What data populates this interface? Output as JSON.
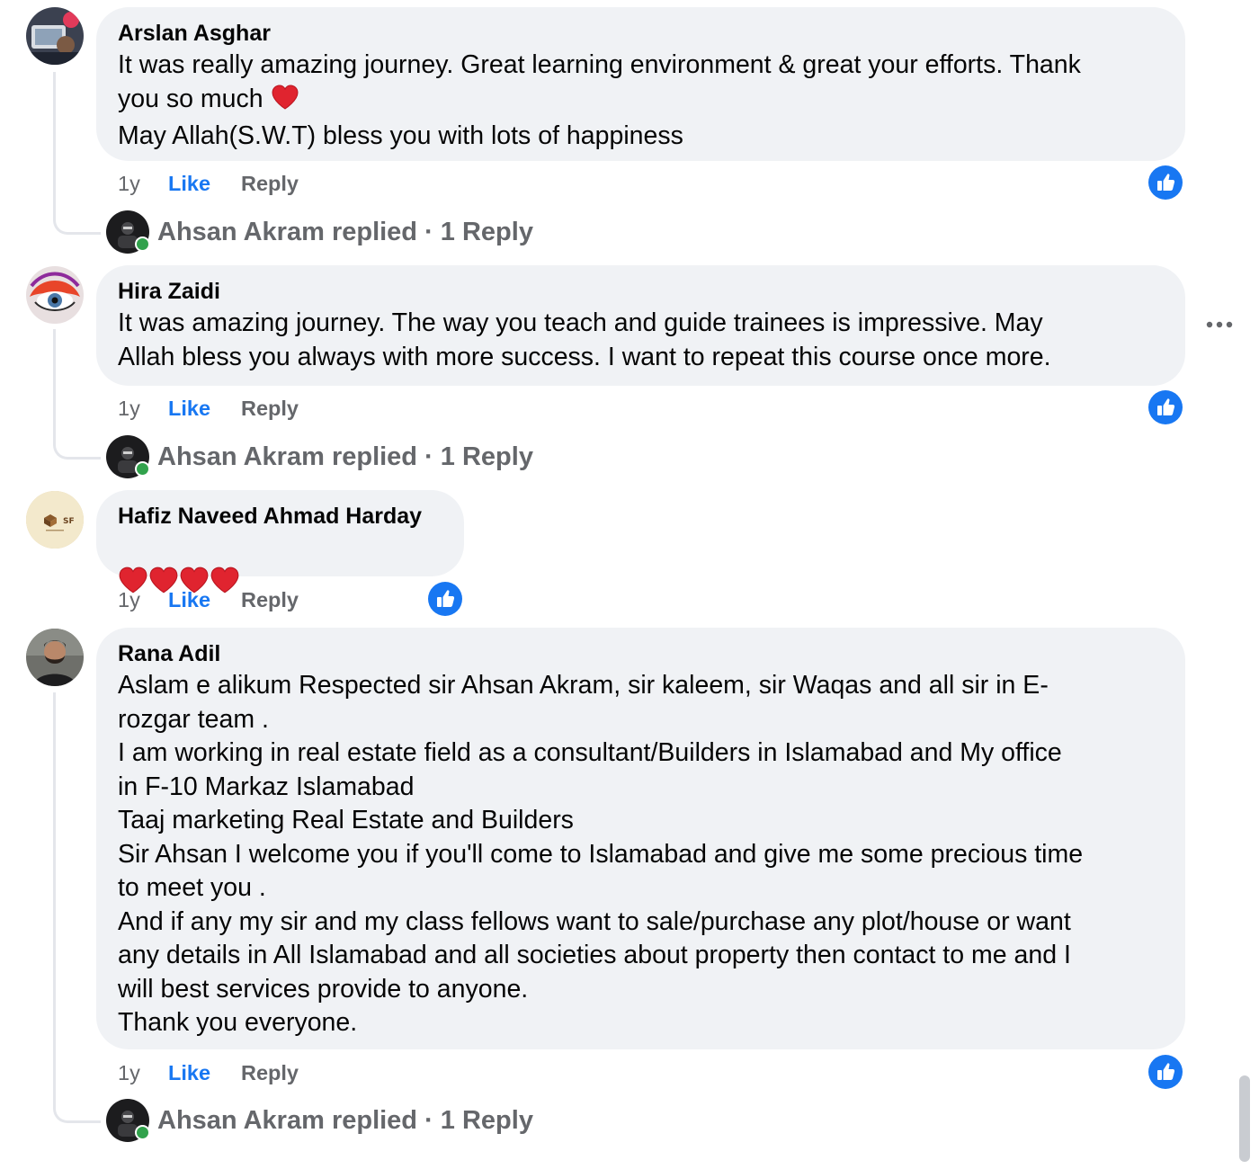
{
  "comments": [
    {
      "author": "Arslan Asghar",
      "text": "It was really amazing journey. Great learning environment & great your efforts. Thank\nyou so much",
      "text_after_emoji": "May Allah(S.W.T) bless you with lots of happiness",
      "emoji": "red-heart",
      "time": "1y",
      "like_label": "Like",
      "reply_label": "Reply",
      "replies_summary": "Ahsan Akram replied · 1 Reply"
    },
    {
      "author": "Hira Zaidi",
      "text": "It was amazing journey. The way you teach and guide trainees is impressive. May\nAllah bless you always with more success. I want to repeat this course once more.",
      "time": "1y",
      "like_label": "Like",
      "reply_label": "Reply",
      "replies_summary": "Ahsan Akram replied · 1 Reply"
    },
    {
      "author": "Hafiz Naveed Ahmad Harday",
      "emoji": "red-heart",
      "emoji_count": 4,
      "time": "1y",
      "like_label": "Like",
      "reply_label": "Reply",
      "avatar_text": "SF"
    },
    {
      "author": "Rana Adil",
      "text": "Aslam e alikum Respected sir Ahsan Akram, sir kaleem, sir Waqas and all sir in E-\nrozgar team .\nI am working in real estate field as a consultant/Builders in Islamabad and My office\nin F-10 Markaz Islamabad\nTaaj marketing Real Estate and Builders\nSir Ahsan I welcome you if you'll come to Islamabad and give me some precious time\nto meet you .\nAnd if any my sir and my class fellows want to sale/purchase any plot/house or want\nany details in All Islamabad and all societies about property then contact to me and I\nwill best services provide to anyone.\nThank you everyone.",
      "time": "1y",
      "like_label": "Like",
      "reply_label": "Reply",
      "replies_summary": "Ahsan Akram replied · 1 Reply"
    }
  ],
  "icons": {
    "like_reaction": "thumbs-up-icon",
    "more_options": "more-horizontal-icon",
    "online_status": "online-dot"
  },
  "colors": {
    "bubble": "#f0f2f5",
    "like_blue": "#1877f2",
    "secondary_text": "#65676b",
    "online_green": "#31a24c",
    "thread_line": "#e4e6eb"
  }
}
